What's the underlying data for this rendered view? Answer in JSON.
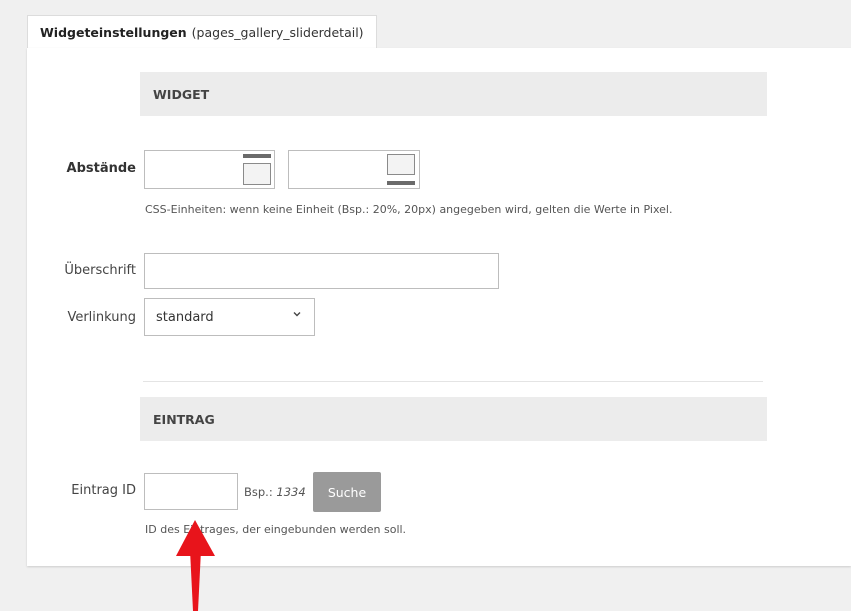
{
  "tab": {
    "title": "Widgeteinstellungen",
    "subtitle": "(pages_gallery_sliderdetail)"
  },
  "section_widget": {
    "title": "WIDGET"
  },
  "spacing": {
    "label": "Abstände",
    "top_value": "",
    "bottom_value": "",
    "hint": "CSS-Einheiten: wenn keine Einheit (Bsp.: 20%, 20px) angegeben wird, gelten die Werte in Pixel."
  },
  "heading": {
    "label": "Überschrift",
    "value": ""
  },
  "link": {
    "label": "Verlinkung",
    "selected": "standard"
  },
  "section_entry": {
    "title": "EINTRAG"
  },
  "entry": {
    "label": "Eintrag ID",
    "value": "",
    "example_prefix": "Bsp.:",
    "example_value": "1334",
    "search_label": "Suche",
    "hint": "ID des Eintrages, der eingebunden werden soll."
  },
  "colors": {
    "arrow": "#e8141b",
    "button": "#9a9a9a",
    "section_bg": "#ececec"
  },
  "icons": [
    "spacing-top-icon",
    "spacing-bottom-icon",
    "chevron-down-icon",
    "red-arrow-icon"
  ]
}
